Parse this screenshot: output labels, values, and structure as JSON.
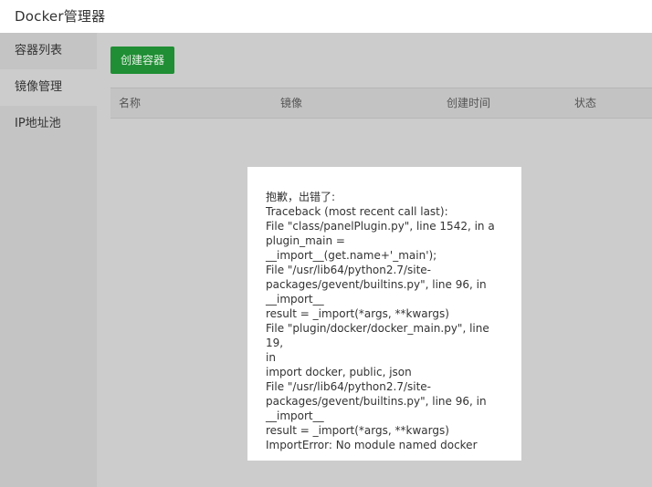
{
  "app": {
    "title": "Docker管理器"
  },
  "sidebar": {
    "items": [
      {
        "label": "容器列表"
      },
      {
        "label": "镜像管理"
      },
      {
        "label": "IP地址池"
      }
    ]
  },
  "toolbar": {
    "create_label": "创建容器"
  },
  "table": {
    "columns": [
      "名称",
      "镜像",
      "创建时间",
      "状态"
    ]
  },
  "error": {
    "lines": [
      "抱歉，出错了:",
      "Traceback (most recent call last):",
      "File \"class/panelPlugin.py\", line 1542, in a",
      "plugin_main =",
      "__import__(get.name+'_main');",
      "File \"/usr/lib64/python2.7/site-",
      "packages/gevent/builtins.py\", line 96, in",
      "__import__",
      "result = _import(*args, **kwargs)",
      "File \"plugin/docker/docker_main.py\", line 19,",
      "in",
      "import docker, public, json",
      "File \"/usr/lib64/python2.7/site-",
      "packages/gevent/builtins.py\", line 96, in",
      "__import__",
      "result = _import(*args, **kwargs)",
      "ImportError: No module named docker"
    ]
  }
}
